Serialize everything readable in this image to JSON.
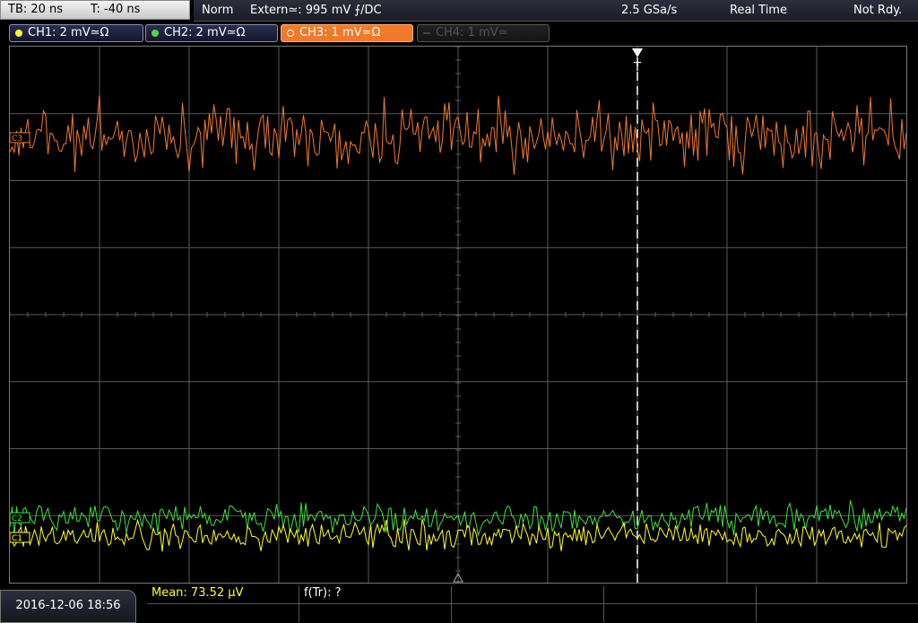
{
  "header": {
    "timebase": "TB: 20 ns",
    "trigger_time": "T: -40 ns",
    "mode": "Norm",
    "trigger_source": "Extern≃: 995 mV ⨍/DC",
    "sample_rate": "2.5 GSa/s",
    "acq_mode": "Real Time",
    "status": "Not Rdy."
  },
  "channels": [
    {
      "label": "CH1: 2 mV≃Ω",
      "color": "#ffff20",
      "state": "on"
    },
    {
      "label": "CH2: 2 mV≃Ω",
      "color": "#40e040",
      "state": "on"
    },
    {
      "label": "CH3: 1 mV≃Ω",
      "color": "#f07a2a",
      "state": "active"
    },
    {
      "label": "CH4: 1 mV≃",
      "color": "#555555",
      "state": "off"
    }
  ],
  "markers": {
    "trigger_glyph": "T",
    "ch3_marker": "C3",
    "ch2_marker": "C2",
    "ch1_marker": "C1"
  },
  "footer": {
    "datetime": "2016-12-06 18:56",
    "mean_label": "Mean: 73.52 μV",
    "ftr_label": "f(Tr): ?"
  },
  "colors": {
    "ch1": "#ffff20",
    "ch2": "#40e040",
    "ch3": "#f07a2a",
    "grid": "#5a5a5a"
  }
}
